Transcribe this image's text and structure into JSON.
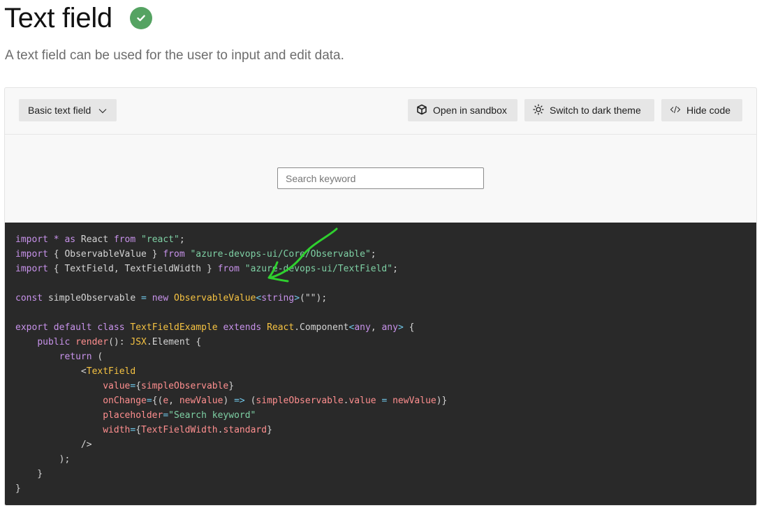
{
  "page": {
    "title": "Text field",
    "subtitle": "A text field can be used for the user to input and edit data.",
    "status_icon": "check-circle-icon",
    "status_color": "#55a362"
  },
  "toolbar": {
    "variant_label": "Basic text field",
    "sandbox_label": "Open in sandbox",
    "theme_label": "Switch to dark theme",
    "code_label": "Hide code"
  },
  "demo": {
    "search_placeholder": "Search keyword",
    "search_value": ""
  },
  "code": [
    [
      [
        "k",
        "import"
      ],
      [
        "x",
        " "
      ],
      [
        "k",
        "*"
      ],
      [
        "x",
        " "
      ],
      [
        "k",
        "as"
      ],
      [
        "x",
        " React "
      ],
      [
        "k",
        "from"
      ],
      [
        "x",
        " "
      ],
      [
        "s",
        "\"react\""
      ],
      [
        "x",
        ";"
      ]
    ],
    [
      [
        "k",
        "import"
      ],
      [
        "x",
        " { ObservableValue } "
      ],
      [
        "k",
        "from"
      ],
      [
        "x",
        " "
      ],
      [
        "s",
        "\"azure-devops-ui/Core/Observable\""
      ],
      [
        "x",
        ";"
      ]
    ],
    [
      [
        "k",
        "import"
      ],
      [
        "x",
        " { TextField, TextFieldWidth } "
      ],
      [
        "k",
        "from"
      ],
      [
        "x",
        " "
      ],
      [
        "s",
        "\"azure-devops-ui/TextField\""
      ],
      [
        "x",
        ";"
      ]
    ],
    [],
    [
      [
        "k",
        "const"
      ],
      [
        "x",
        " simpleObservable "
      ],
      [
        "o",
        "="
      ],
      [
        "x",
        " "
      ],
      [
        "k",
        "new"
      ],
      [
        "x",
        " "
      ],
      [
        "t",
        "ObservableValue"
      ],
      [
        "o",
        "<"
      ],
      [
        "k",
        "string"
      ],
      [
        "o",
        ">"
      ],
      [
        "x",
        "(\"\");"
      ]
    ],
    [],
    [
      [
        "k",
        "export"
      ],
      [
        "x",
        " "
      ],
      [
        "k",
        "default"
      ],
      [
        "x",
        " "
      ],
      [
        "k",
        "class"
      ],
      [
        "x",
        " "
      ],
      [
        "t",
        "TextFieldExample"
      ],
      [
        "x",
        " "
      ],
      [
        "k",
        "extends"
      ],
      [
        "x",
        " "
      ],
      [
        "t",
        "React"
      ],
      [
        "x",
        "."
      ],
      [
        "x",
        "Component"
      ],
      [
        "o",
        "<"
      ],
      [
        "k",
        "any"
      ],
      [
        "x",
        ", "
      ],
      [
        "k",
        "any"
      ],
      [
        "o",
        ">"
      ],
      [
        "x",
        " {"
      ]
    ],
    [
      [
        "x",
        "    "
      ],
      [
        "k",
        "public"
      ],
      [
        "x",
        " "
      ],
      [
        "p",
        "render"
      ],
      [
        "x",
        "(): "
      ],
      [
        "t",
        "JSX"
      ],
      [
        "x",
        ".Element {"
      ]
    ],
    [
      [
        "x",
        "        "
      ],
      [
        "k",
        "return"
      ],
      [
        "x",
        " ("
      ]
    ],
    [
      [
        "x",
        "            <"
      ],
      [
        "t",
        "TextField"
      ]
    ],
    [
      [
        "x",
        "                "
      ],
      [
        "p",
        "value"
      ],
      [
        "o",
        "="
      ],
      [
        "x",
        "{"
      ],
      [
        "p",
        "simpleObservable"
      ],
      [
        "x",
        "}"
      ]
    ],
    [
      [
        "x",
        "                "
      ],
      [
        "p",
        "onChange"
      ],
      [
        "o",
        "="
      ],
      [
        "x",
        "{("
      ],
      [
        "p",
        "e"
      ],
      [
        "x",
        ", "
      ],
      [
        "p",
        "newValue"
      ],
      [
        "x",
        ") "
      ],
      [
        "o",
        "=>"
      ],
      [
        "x",
        " ("
      ],
      [
        "p",
        "simpleObservable"
      ],
      [
        "x",
        "."
      ],
      [
        "p",
        "value"
      ],
      [
        "x",
        " "
      ],
      [
        "o",
        "="
      ],
      [
        "x",
        " "
      ],
      [
        "p",
        "newValue"
      ],
      [
        "x",
        ")}"
      ]
    ],
    [
      [
        "x",
        "                "
      ],
      [
        "p",
        "placeholder"
      ],
      [
        "o",
        "="
      ],
      [
        "s",
        "\"Search keyword\""
      ]
    ],
    [
      [
        "x",
        "                "
      ],
      [
        "p",
        "width"
      ],
      [
        "o",
        "="
      ],
      [
        "x",
        "{"
      ],
      [
        "p",
        "TextFieldWidth"
      ],
      [
        "x",
        "."
      ],
      [
        "p",
        "standard"
      ],
      [
        "x",
        "}"
      ]
    ],
    [
      [
        "x",
        "            />"
      ]
    ],
    [
      [
        "x",
        "        );"
      ]
    ],
    [
      [
        "x",
        "    }"
      ]
    ],
    [
      [
        "x",
        "}"
      ]
    ]
  ]
}
